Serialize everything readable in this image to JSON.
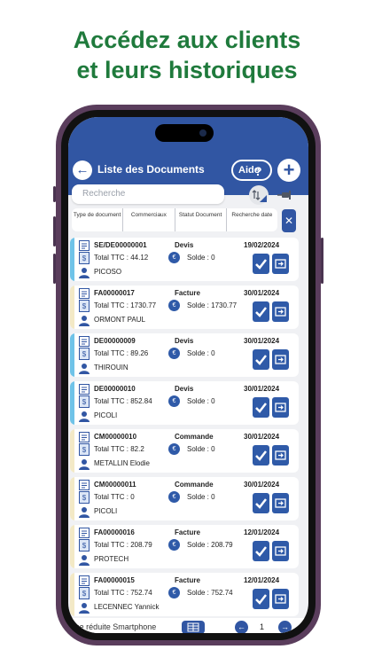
{
  "headline": {
    "line1": "Accédez aux clients",
    "line2": "et leurs historiques"
  },
  "colors": {
    "accent": "#3156a3",
    "headline": "#1f7a3c",
    "devis_stripe": "#6fc3e8",
    "other_stripe": "#f3e9c6"
  },
  "header": {
    "title": "Liste des Documents",
    "aide_label": "Aide",
    "aide_icon": "question-icon",
    "back_icon": "arrow-left-icon",
    "add_icon": "plus-icon"
  },
  "search": {
    "placeholder": "Recherche"
  },
  "filters": [
    {
      "label": "Type de document"
    },
    {
      "label": "Commerciaux"
    },
    {
      "label": "Statut Document"
    },
    {
      "label": "Recherche date"
    }
  ],
  "documents": [
    {
      "ref": "SE/DE00000001",
      "type": "Devis",
      "date": "19/02/2024",
      "total": "Total TTC : 44.12",
      "solde": "Solde : 0",
      "client": "PICOSO",
      "stripe": "devis"
    },
    {
      "ref": "FA00000017",
      "type": "Facture",
      "date": "30/01/2024",
      "total": "Total TTC : 1730.77",
      "solde": "Solde : 1730.77",
      "client": "ORMONT PAUL",
      "stripe": "other"
    },
    {
      "ref": "DE00000009",
      "type": "Devis",
      "date": "30/01/2024",
      "total": "Total TTC : 89.26",
      "solde": "Solde : 0",
      "client": "THIROUIN",
      "stripe": "devis"
    },
    {
      "ref": "DE00000010",
      "type": "Devis",
      "date": "30/01/2024",
      "total": "Total TTC : 852.84",
      "solde": "Solde : 0",
      "client": "PICOLI",
      "stripe": "devis"
    },
    {
      "ref": "CM00000010",
      "type": "Commande",
      "date": "30/01/2024",
      "total": "Total TTC : 82.2",
      "solde": "Solde : 0",
      "client": "METALLIN Elodie",
      "stripe": "other"
    },
    {
      "ref": "CM00000011",
      "type": "Commande",
      "date": "30/01/2024",
      "total": "Total TTC : 0",
      "solde": "Solde : 0",
      "client": "PICOLI",
      "stripe": "other"
    },
    {
      "ref": "FA00000016",
      "type": "Facture",
      "date": "12/01/2024",
      "total": "Total TTC : 208.79",
      "solde": "Solde : 208.79",
      "client": "PROTECH",
      "stripe": "other"
    },
    {
      "ref": "FA00000015",
      "type": "Facture",
      "date": "12/01/2024",
      "total": "Total TTC : 752.74",
      "solde": "Solde : 752.74",
      "client": "LECENNEC Yannick",
      "stripe": "other"
    }
  ],
  "footer": {
    "view_label": "Vue réduite Smartphone",
    "page": "1"
  }
}
